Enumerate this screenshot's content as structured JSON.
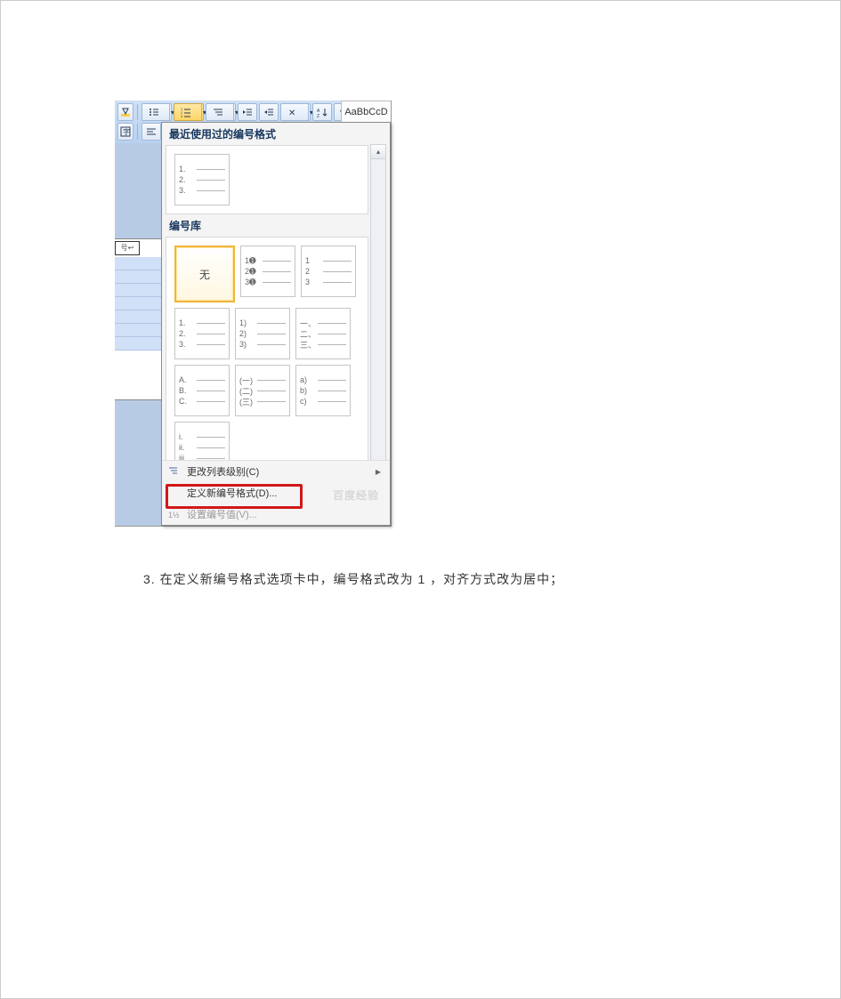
{
  "ribbon": {
    "style_sample": "AaBbCcD"
  },
  "panel": {
    "recent_header": "最近使用过的编号格式",
    "library_header": "编号库",
    "none_label": "无",
    "recent_thumb": [
      "1.",
      "2.",
      "3."
    ],
    "library": [
      [
        {
          "type": "none"
        },
        {
          "labels": [
            "1➊",
            "2➊",
            "3➊"
          ]
        },
        {
          "labels": [
            "1",
            "2",
            "3"
          ]
        }
      ],
      [
        {
          "labels": [
            "1.",
            "2.",
            "3."
          ]
        },
        {
          "labels": [
            "1)",
            "2)",
            "3)"
          ]
        },
        {
          "labels": [
            "一、",
            "二、",
            "三、"
          ]
        }
      ],
      [
        {
          "labels": [
            "A.",
            "B.",
            "C."
          ]
        },
        {
          "labels": [
            "(一)",
            "(二)",
            "(三)"
          ]
        },
        {
          "labels": [
            "a)",
            "b)",
            "c)"
          ]
        }
      ],
      [
        {
          "labels": [
            "i.",
            "ii.",
            "iii."
          ]
        }
      ]
    ],
    "footer": {
      "change_level": "更改列表级别(C)",
      "define_new": "定义新编号格式(D)...",
      "set_value": "设置编号值(V)..."
    }
  },
  "caption": "3. 在定义新编号格式选项卡中，编号格式改为 1 ，对齐方式改为居中；",
  "watermark": "百度经验"
}
